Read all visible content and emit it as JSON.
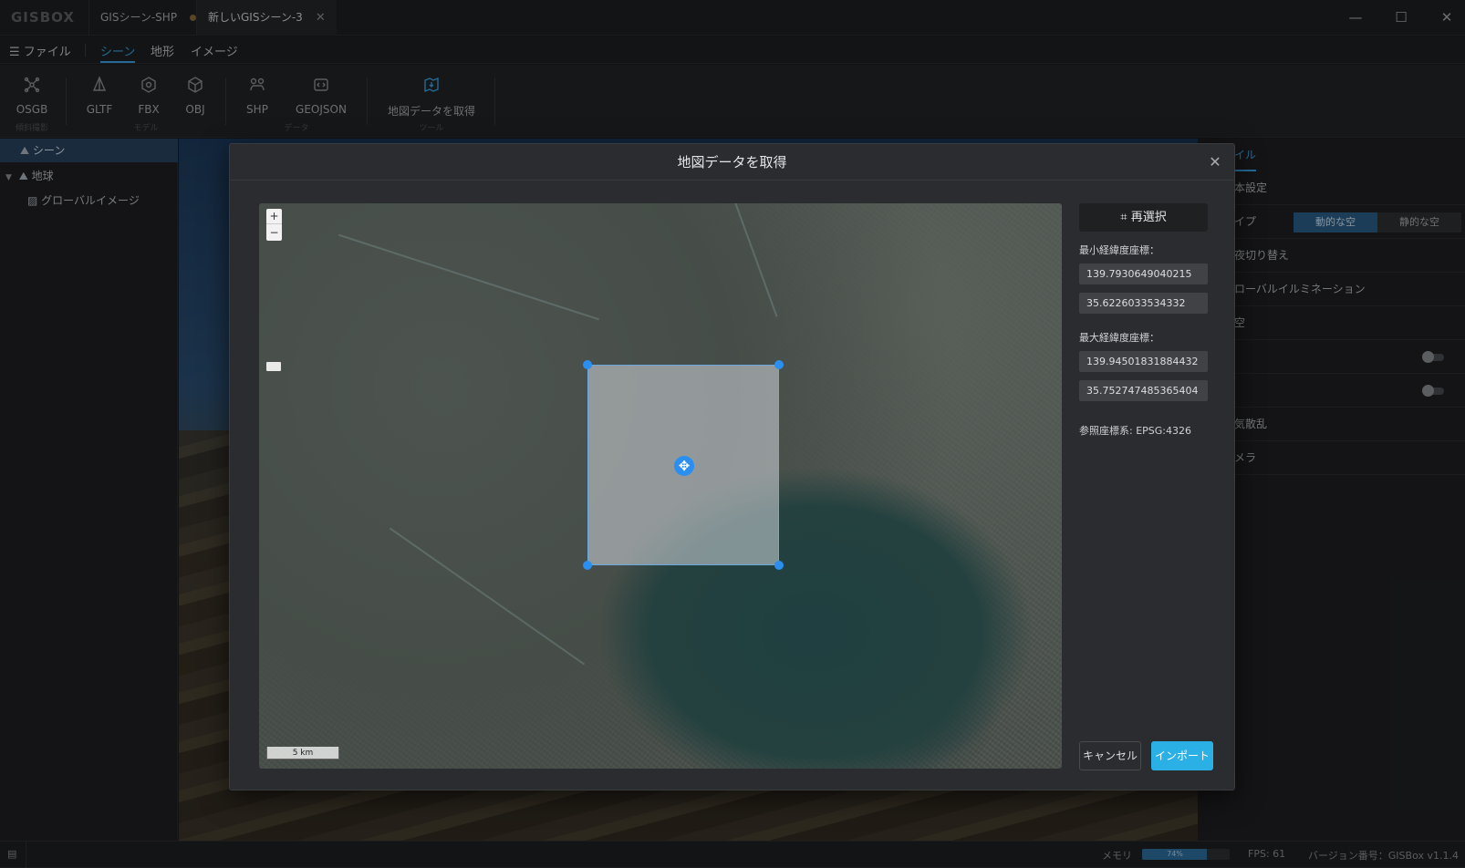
{
  "app": {
    "logo": "GISBOX",
    "tabs": [
      {
        "label": "GISシーン-SHP",
        "modified": true
      },
      {
        "label": "新しいGISシーン-3",
        "close": "✕"
      }
    ],
    "window_controls": {
      "minimize": "—",
      "maximize": "☐",
      "close": "✕"
    }
  },
  "menu": {
    "file": "☰ ファイル",
    "items": [
      "シーン",
      "地形",
      "イメージ"
    ],
    "active": "シーン"
  },
  "toolbar": {
    "tools": [
      {
        "label": "OSGB",
        "icon": "osgb-icon"
      },
      {
        "label": "GLTF",
        "icon": "gltf-icon"
      },
      {
        "label": "FBX",
        "icon": "fbx-icon"
      },
      {
        "label": "OBJ",
        "icon": "obj-icon"
      },
      {
        "label": "SHP",
        "icon": "shp-icon"
      },
      {
        "label": "GEOJSON",
        "icon": "geojson-icon"
      },
      {
        "label": "地図データを取得",
        "icon": "map-download-icon"
      }
    ],
    "groups": [
      "傾斜撮影",
      "モデル",
      "データ",
      "ツール"
    ]
  },
  "scene_tree": {
    "items": [
      {
        "label": "シーン",
        "selected": true
      },
      {
        "label": "地球",
        "expanded": true
      },
      {
        "label": "グローバルイメージ"
      }
    ]
  },
  "right_panel": {
    "tab": "イル",
    "rows": [
      "本設定",
      "イプ",
      "夜切り替え",
      "ローバルイルミネーション",
      "空",
      "",
      "",
      "気散乱",
      "メラ"
    ],
    "sky_type_options": [
      "動的な空",
      "静的な空"
    ],
    "sky_type_selected": "動的な空"
  },
  "modal": {
    "title": "地図データを取得",
    "reselect_label": "再選択",
    "min_label": "最小経緯度座標：",
    "min_lon": "139.7930649040215",
    "min_lat": "35.6226033534332",
    "max_label": "最大経緯度座標：",
    "max_lon": "139.94501831884432",
    "max_lat": "35.752747485365404",
    "crs_label": "参照座標系: EPSG:4326",
    "cancel_label": "キャンセル",
    "import_label": "インポート",
    "map": {
      "zoom_in": "+",
      "zoom_out": "−",
      "scale_label": "5 km",
      "move_icon": "✥"
    }
  },
  "status": {
    "memory_label": "メモリ",
    "memory_percent": 74,
    "memory_text": "74%",
    "fps": "FPS: 61",
    "version": "バージョン番号：GISBox v1.1.4"
  },
  "colors": {
    "accent": "#3aa3e6",
    "import_button": "#2bb0e6",
    "selection_handle": "#2a8ff0"
  }
}
